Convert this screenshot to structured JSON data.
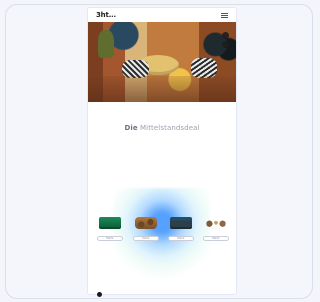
{
  "app": {
    "logo_text": "3ht...",
    "headline_prefix": "Die",
    "headline_suffix": "Mittelstandsdeal"
  },
  "products": [
    {
      "name": "green-sofa",
      "button": "Mehr"
    },
    {
      "name": "wood-table",
      "button": "Mehr"
    },
    {
      "name": "bed",
      "button": "Mehr"
    },
    {
      "name": "chairs",
      "button": "Mehr"
    }
  ]
}
